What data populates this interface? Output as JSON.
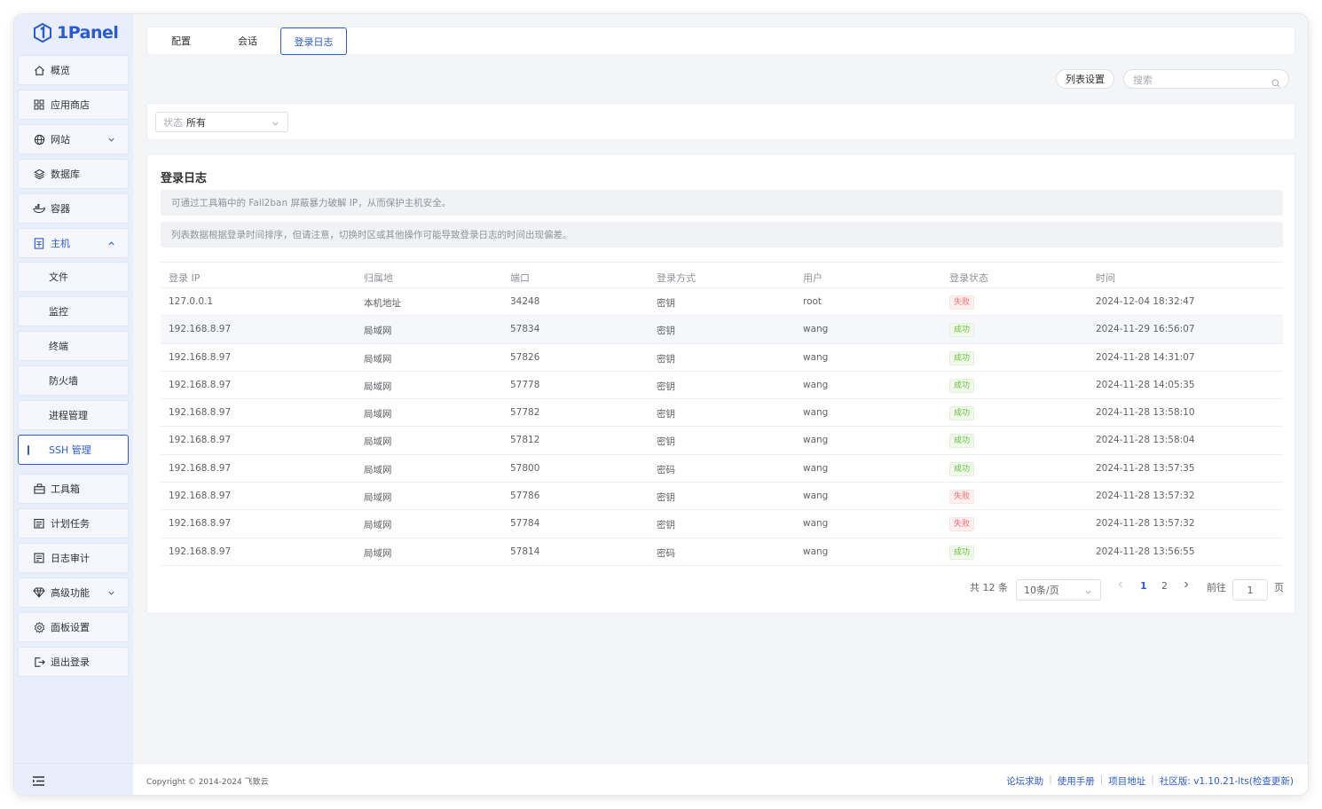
{
  "brand": {
    "name": "1Panel",
    "color": "#2a5ad6"
  },
  "sidebar": {
    "items": [
      {
        "label": "概览",
        "icon": "home-icon"
      },
      {
        "label": "应用商店",
        "icon": "grid-icon"
      },
      {
        "label": "网站",
        "icon": "globe-icon"
      },
      {
        "label": "数据库",
        "icon": "layers-icon"
      },
      {
        "label": "容器",
        "icon": "docker-icon"
      },
      {
        "label": "主机",
        "icon": "host-icon"
      },
      {
        "label": "文件"
      },
      {
        "label": "监控"
      },
      {
        "label": "终端"
      },
      {
        "label": "防火墙"
      },
      {
        "label": "进程管理"
      },
      {
        "label": "SSH 管理"
      },
      {
        "label": "工具箱",
        "icon": "toolbox-icon"
      },
      {
        "label": "计划任务",
        "icon": "calendar-icon"
      },
      {
        "label": "日志审计",
        "icon": "log-icon"
      },
      {
        "label": "高级功能",
        "icon": "diamond-icon"
      },
      {
        "label": "面板设置",
        "icon": "gear-icon"
      },
      {
        "label": "退出登录",
        "icon": "logout-icon"
      }
    ]
  },
  "tabs": [
    {
      "label": "配置"
    },
    {
      "label": "会话"
    },
    {
      "label": "登录日志"
    }
  ],
  "toolbar": {
    "columns_label": "列表设置",
    "search_placeholder": "搜索"
  },
  "filter": {
    "status_label": "状态",
    "status_value": "所有"
  },
  "card": {
    "title": "登录日志",
    "notices": [
      "可通过工具箱中的 Fail2ban 屏蔽暴力破解 IP，从而保护主机安全。",
      "列表数据根据登录时间排序，但请注意，切换时区或其他操作可能导致登录日志的时间出现偏差。"
    ]
  },
  "table": {
    "headers": [
      "登录 IP",
      "归属地",
      "端口",
      "登录方式",
      "用户",
      "登录状态",
      "时间"
    ],
    "rows": [
      {
        "ip": "127.0.0.1",
        "area": "本机地址",
        "port": "34248",
        "method": "密钥",
        "user": "root",
        "status": "失败",
        "time": "2024-12-04 18:32:47"
      },
      {
        "ip": "192.168.8.97",
        "area": "局域网",
        "port": "57834",
        "method": "密钥",
        "user": "wang",
        "status": "成功",
        "time": "2024-11-29 16:56:07"
      },
      {
        "ip": "192.168.8.97",
        "area": "局域网",
        "port": "57826",
        "method": "密钥",
        "user": "wang",
        "status": "成功",
        "time": "2024-11-28 14:31:07"
      },
      {
        "ip": "192.168.8.97",
        "area": "局域网",
        "port": "57778",
        "method": "密钥",
        "user": "wang",
        "status": "成功",
        "time": "2024-11-28 14:05:35"
      },
      {
        "ip": "192.168.8.97",
        "area": "局域网",
        "port": "57782",
        "method": "密钥",
        "user": "wang",
        "status": "成功",
        "time": "2024-11-28 13:58:10"
      },
      {
        "ip": "192.168.8.97",
        "area": "局域网",
        "port": "57812",
        "method": "密钥",
        "user": "wang",
        "status": "成功",
        "time": "2024-11-28 13:58:04"
      },
      {
        "ip": "192.168.8.97",
        "area": "局域网",
        "port": "57800",
        "method": "密码",
        "user": "wang",
        "status": "成功",
        "time": "2024-11-28 13:57:35"
      },
      {
        "ip": "192.168.8.97",
        "area": "局域网",
        "port": "57786",
        "method": "密钥",
        "user": "wang",
        "status": "失败",
        "time": "2024-11-28 13:57:32"
      },
      {
        "ip": "192.168.8.97",
        "area": "局域网",
        "port": "57784",
        "method": "密钥",
        "user": "wang",
        "status": "失败",
        "time": "2024-11-28 13:57:32"
      },
      {
        "ip": "192.168.8.97",
        "area": "局域网",
        "port": "57814",
        "method": "密码",
        "user": "wang",
        "status": "成功",
        "time": "2024-11-28 13:56:55"
      }
    ]
  },
  "pagination": {
    "total": "共 12 条",
    "page_size": "10条/页",
    "pages": [
      "1",
      "2"
    ],
    "goto_label": "前往",
    "goto_value": "1",
    "page_suffix": "页"
  },
  "footer": {
    "copyright": "Copyright © 2014-2024 飞致云",
    "links": [
      "论坛求助",
      "使用手册",
      "项目地址"
    ],
    "version": "社区版: v1.10.21-lts",
    "check_update": "(检查更新)"
  }
}
